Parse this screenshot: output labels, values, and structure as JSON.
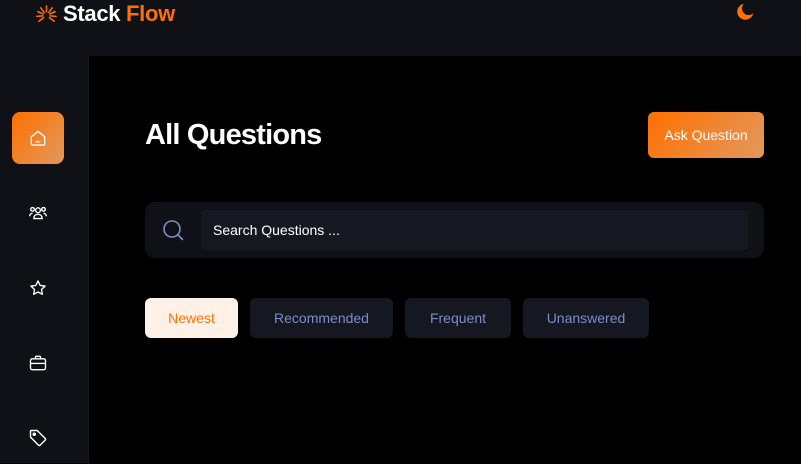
{
  "header": {
    "brand_main": "Stack",
    "brand_accent": "Flow",
    "theme_icon": "moon-icon",
    "accent_color": "#ff7000"
  },
  "sidebar": {
    "items": [
      {
        "icon": "home-icon",
        "active": true
      },
      {
        "icon": "users-icon",
        "active": false
      },
      {
        "icon": "star-icon",
        "active": false
      },
      {
        "icon": "briefcase-icon",
        "active": false
      },
      {
        "icon": "tag-icon",
        "active": false
      }
    ]
  },
  "main": {
    "title": "All Questions",
    "ask_button": "Ask Question",
    "search": {
      "placeholder": "Search Questions ...",
      "value": ""
    },
    "filters": [
      {
        "label": "Newest",
        "active": true
      },
      {
        "label": "Recommended",
        "active": false
      },
      {
        "label": "Frequent",
        "active": false
      },
      {
        "label": "Unanswered",
        "active": false
      }
    ]
  }
}
